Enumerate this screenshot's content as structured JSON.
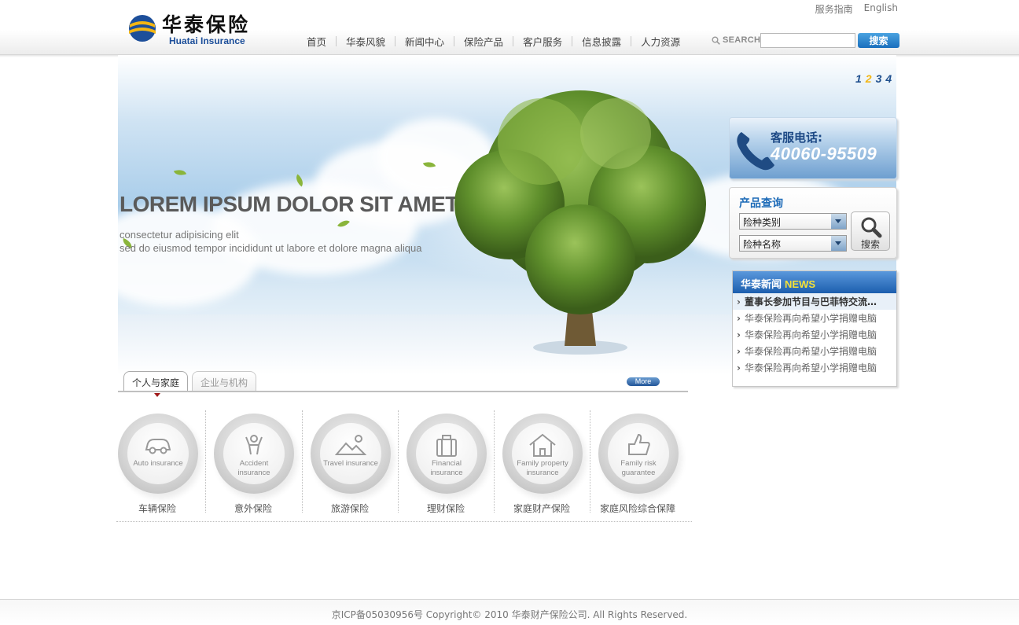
{
  "brand": {
    "name_cn": "华泰保险",
    "name_en": "Huatai Insurance",
    "colors": {
      "blue": "#1d4f9a",
      "yellow": "#f3b614"
    }
  },
  "top_links": [
    "服务指南",
    "English"
  ],
  "nav": [
    "首页",
    "华泰风貌",
    "新闻中心",
    "保险产品",
    "客户服务",
    "信息披露",
    "人力资源"
  ],
  "search": {
    "label": "SEARCH",
    "value": "",
    "button": "搜索"
  },
  "banner": {
    "title": "LOREM IPSUM DOLOR SIT AMET",
    "subtitle_1": "consectetur adipisicing elit",
    "subtitle_2": "sed do eiusmod tempor incididunt ut labore et dolore magna aliqua",
    "pages": [
      "1",
      "2",
      "3",
      "4"
    ],
    "active_page": "2"
  },
  "hotline": {
    "label": "客服电话:",
    "number": "40060-95509"
  },
  "product_query": {
    "title": "产品查询",
    "select_type": "险种类别",
    "select_name": "险种名称",
    "button": "搜索"
  },
  "news": {
    "title_cn": "华泰新闻",
    "title_en": "NEWS",
    "items": [
      "董事长参加节目与巴菲特交流…",
      "华泰保险再向希望小学捐赠电脑",
      "华泰保险再向希望小学捐赠电脑",
      "华泰保险再向希望小学捐赠电脑",
      "华泰保险再向希望小学捐赠电脑"
    ]
  },
  "tabs": [
    "个人与家庭",
    "企业与机构"
  ],
  "more": "More",
  "products": [
    {
      "icon": "car-icon",
      "en_1": "Auto insurance",
      "en_2": "",
      "cn": "车辆保险"
    },
    {
      "icon": "person-icon",
      "en_1": "Accident",
      "en_2": "insurance",
      "cn": "意外保险"
    },
    {
      "icon": "landscape-icon",
      "en_1": "Travel insurance",
      "en_2": "",
      "cn": "旅游保险"
    },
    {
      "icon": "briefcase-icon",
      "en_1": "Financial",
      "en_2": "insurance",
      "cn": "理财保险"
    },
    {
      "icon": "house-icon",
      "en_1": "Family property",
      "en_2": "insurance",
      "cn": "家庭财产保险"
    },
    {
      "icon": "thumbs-up-icon",
      "en_1": "Family risk",
      "en_2": "guarantee",
      "cn": "家庭风险综合保障"
    }
  ],
  "footer": "京ICP备05030956号 Copyright© 2010 华泰财产保险公司. All Rights Reserved."
}
